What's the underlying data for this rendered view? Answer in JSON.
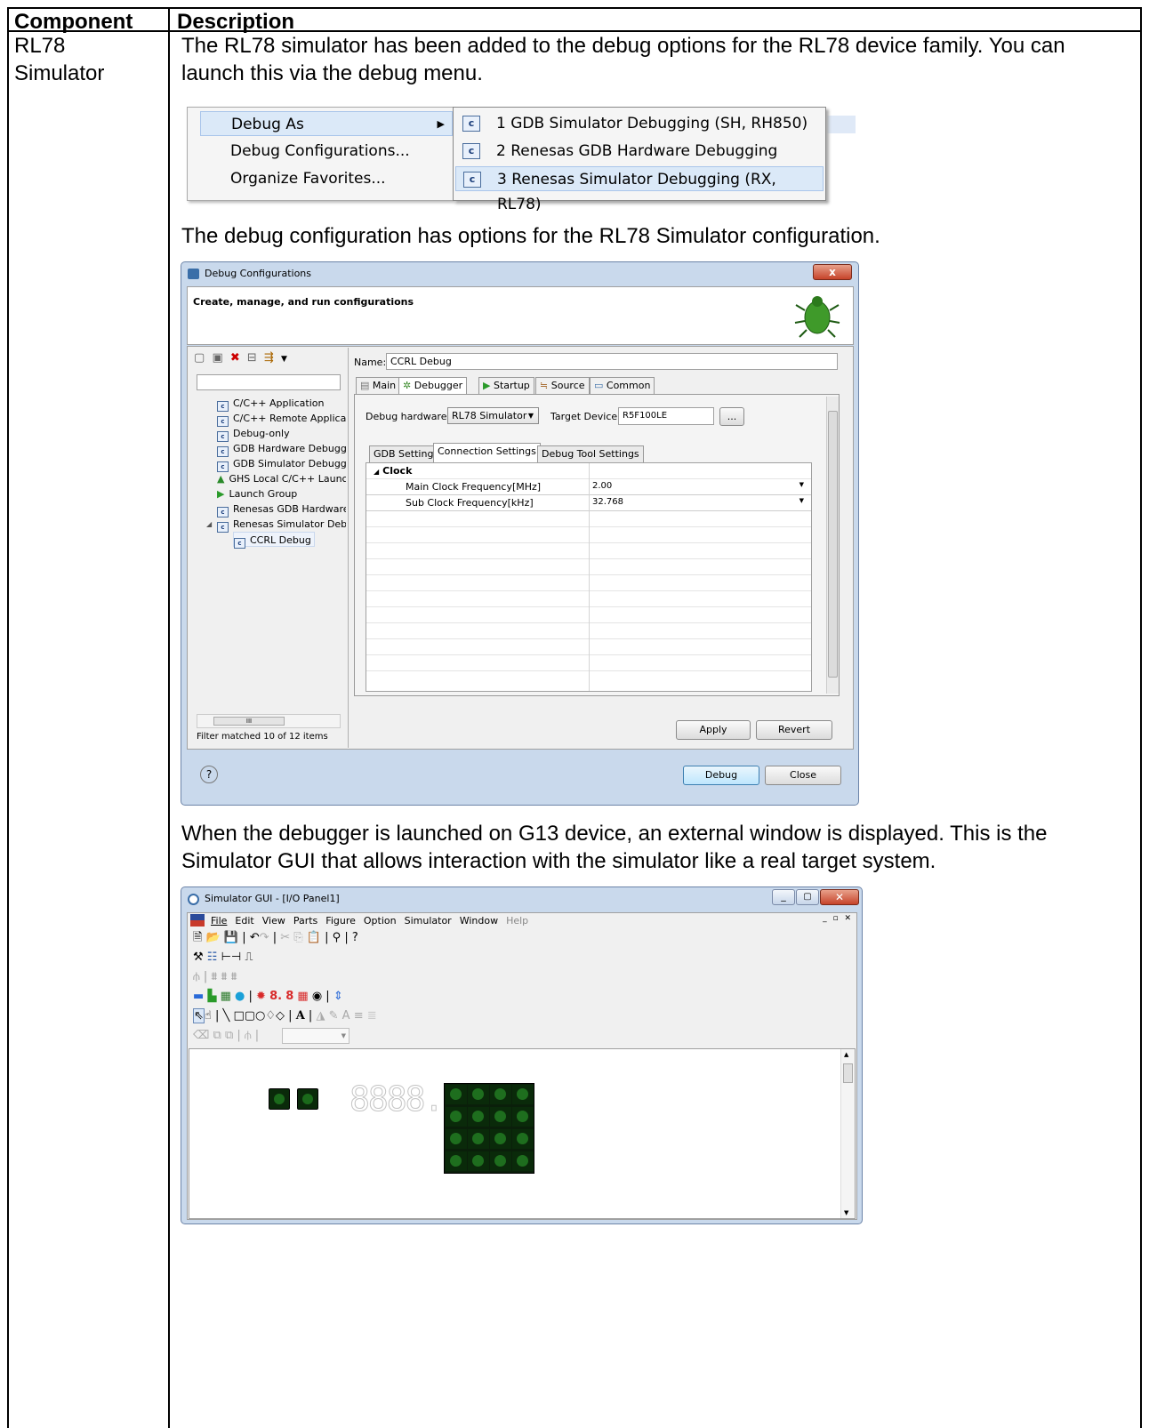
{
  "table": {
    "header_component": "Component",
    "header_description": "Description",
    "component_name": "RL78 Simulator",
    "paragraph1": "The RL78 simulator has been added to the debug options for the RL78 device family. You can launch this via the debug menu.",
    "paragraph2": "The debug configuration has options for the RL78 Simulator configuration.",
    "paragraph3": "When the debugger is launched on G13 device, an external window is displayed. This is the Simulator GUI that allows interaction with the simulator like a real target system."
  },
  "menu": {
    "left_items": [
      "Debug As",
      "Debug Configurations...",
      "Organize Favorites..."
    ],
    "submenu_items": [
      "1 GDB Simulator Debugging (SH, RH850)",
      "2 Renesas GDB Hardware Debugging",
      "3 Renesas Simulator Debugging (RX, RL78)"
    ],
    "arrow": "▶",
    "icon_text": "c"
  },
  "debug_config": {
    "title": "Debug Configurations",
    "subtitle": "Create, manage, and run configurations",
    "tree_items": [
      "C/C++ Application",
      "C/C++ Remote Applicat",
      "Debug-only",
      "GDB Hardware Debuggi",
      "GDB Simulator Debuggi",
      "GHS Local C/C++ Launc",
      "Launch Group",
      "Renesas GDB Hardware",
      "Renesas Simulator Debu",
      "CCRL Debug"
    ],
    "filter_text": "Filter matched 10 of 12 items",
    "name_label": "Name:",
    "name_value": "CCRL Debug",
    "tabs": [
      "Main",
      "Debugger",
      "Startup",
      "Source",
      "Common"
    ],
    "debug_hw_label": "Debug hardware:",
    "debug_hw_value": "RL78 Simulator",
    "target_device_label": "Target Device:",
    "target_device_value": "R5F100LE",
    "browse_label": "...",
    "sub_tabs": [
      "GDB Settings",
      "Connection Settings",
      "Debug Tool Settings"
    ],
    "group_name": "Clock",
    "properties": [
      {
        "name": "Main Clock Frequency[MHz]",
        "value": "2.00"
      },
      {
        "name": "Sub Clock Frequency[kHz]",
        "value": "32.768"
      }
    ],
    "apply_label": "Apply",
    "revert_label": "Revert",
    "debug_label": "Debug",
    "close_label": "Close",
    "help_label": "?",
    "scroll_label": "III",
    "close_x": "x"
  },
  "simulator": {
    "title": "Simulator GUI - [I/O Panel1]",
    "menus": [
      "File",
      "Edit",
      "View",
      "Parts",
      "Figure",
      "Option",
      "Simulator",
      "Window",
      "Help"
    ],
    "seg_text": "8888.",
    "led_count": 2,
    "matrix_size": 4
  }
}
